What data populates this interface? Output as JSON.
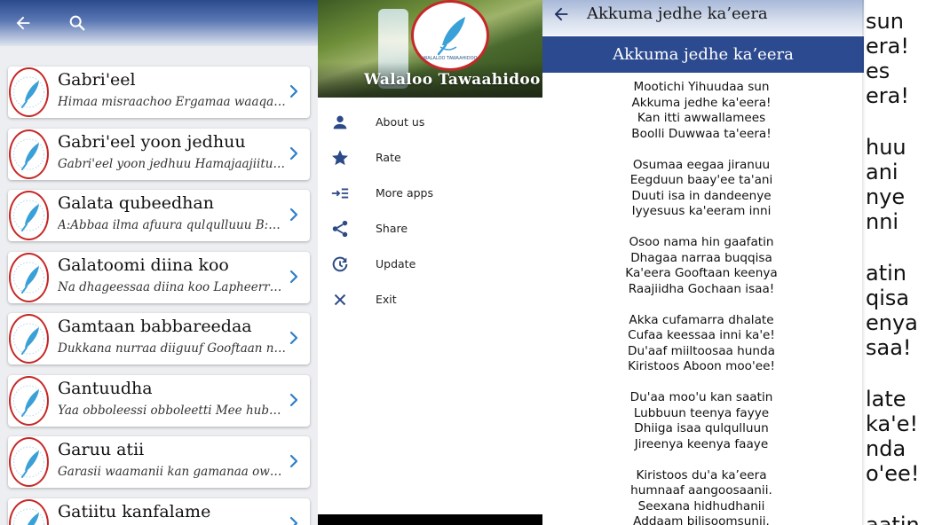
{
  "list_panel": {
    "back_icon": "arrow-left-icon",
    "search_icon": "search-icon",
    "chevron_color": "#2d7fc9",
    "logo_border_color": "#c62828",
    "items": [
      {
        "title": "Gabri'eel",
        "subtitle": "Himaa misraachoo Ergamaa waaqa Taj..."
      },
      {
        "title": "Gabri'eel yoon jedhuu",
        "subtitle": "Gabri'eel yoon jedhuu Hamajaajiitu dhip..."
      },
      {
        "title": "Galata qubeedhan",
        "subtitle": "A:Abbaa ilma afuura qulqulluuu B:Barre..."
      },
      {
        "title": "Galatoomi diina koo",
        "subtitle": "Na dhageessaa diina koo Lapheerran si..."
      },
      {
        "title": "Gamtaan babbareedaa",
        "subtitle": "Dukkana nurraa diiguuf Gooftaan nuuf d..."
      },
      {
        "title": "Gantuudha",
        "subtitle": "Yaa obboleessi obboleetti Mee hubadhu a..."
      },
      {
        "title": "Garuu atii",
        "subtitle": "Garasii waamanii kan gamanaa owwaat..."
      },
      {
        "title": "Gatiitu kanfalame",
        "subtitle": ""
      }
    ]
  },
  "drawer": {
    "app_name": "Walaloo Tawaahidoo",
    "logo_text": "WALALOO TAWAAHIDOO",
    "menu": [
      {
        "label": "About us",
        "icon": "person-icon"
      },
      {
        "label": "Rate",
        "icon": "star-icon"
      },
      {
        "label": "More apps",
        "icon": "more-apps-icon"
      },
      {
        "label": "Share",
        "icon": "share-icon"
      },
      {
        "label": "Update",
        "icon": "update-icon"
      },
      {
        "label": "Exit",
        "icon": "close-icon"
      }
    ],
    "icon_color": "#2c4a87"
  },
  "detail": {
    "appbar_title": "Akkuma jedhe ka’eera",
    "header_title": "Akkuma jedhe ka’eera",
    "header_color": "#2c4a8f",
    "stanzas": [
      [
        "Mootichi Yihuudaa sun",
        "Akkuma jedhe ka'eera!",
        "Kan itti awwallamees",
        "Boolli Duwwaa ta'eera!"
      ],
      [
        "Osumaa eegaa jiranuu",
        "Eegduun baay'ee ta'ani",
        "Duuti isa in dandeenye",
        "Iyyesuus ka'eeram inni"
      ],
      [
        "Osoo nama hin gaafatin",
        "Dhagaa narraa buqqisa",
        "Ka'eera Gooftaan keenya",
        "Raajiidha Gochaan isaa!"
      ],
      [
        "Akka cufamarra dhalate",
        "Cufaa keessaa inni ka'e!",
        "Du'aaf miiltoosaa hunda",
        "Kiristoos Aboon moo'ee!"
      ],
      [
        "Du'aa moo'u kan saatin",
        "Lubbuun teenya fayye",
        "Dhiiga isaa qulqulluun",
        "Jireenya keenya faaye"
      ],
      [
        "Kiristoos du'a ka’eera",
        "humnaaf aangoosaanii.",
        "Seexana hidhudhanii",
        "Addaam bilisoomsunii."
      ]
    ],
    "overflow_lines": [
      "sun",
      "era!",
      "es",
      "era!",
      "huu",
      "ani",
      "nye",
      "nni",
      "atin",
      "qisa",
      "enya",
      "saa!",
      "late",
      "ka'e!",
      "nda",
      "o'ee!",
      "aatin"
    ]
  }
}
